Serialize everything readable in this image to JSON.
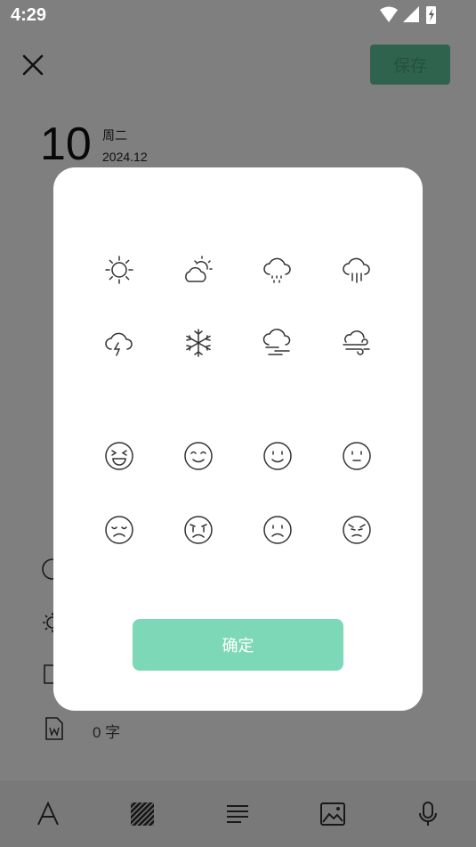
{
  "status_bar": {
    "time": "4:29"
  },
  "header": {
    "save_label": "保存"
  },
  "date": {
    "day": "10",
    "weekday": "周二",
    "year_month": "2024.12"
  },
  "info": {
    "word_count": "0 字"
  },
  "dialog": {
    "weather_icons": [
      "sunny-icon",
      "partly-cloudy-icon",
      "drizzle-icon",
      "rain-icon",
      "thunderstorm-icon",
      "snow-icon",
      "fog-icon",
      "wind-icon"
    ],
    "mood_icons": [
      "laughing-face-icon",
      "content-face-icon",
      "smile-face-icon",
      "neutral-face-icon",
      "sad-face-icon",
      "crying-face-icon",
      "frown-face-icon",
      "angry-face-icon"
    ],
    "confirm_label": "确定"
  },
  "toolbar": {
    "items": [
      "font-icon",
      "texture-icon",
      "align-icon",
      "image-icon",
      "microphone-icon"
    ]
  },
  "colors": {
    "accent": "#7dd8b7",
    "save_button": "#5fc69b",
    "overlay": "rgba(0,0,0,0.5)"
  }
}
